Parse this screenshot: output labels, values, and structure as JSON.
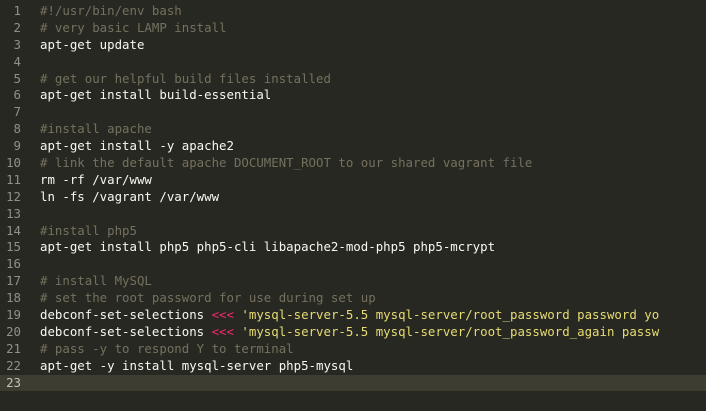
{
  "editor": {
    "language": "bash",
    "active_line": 23,
    "colors": {
      "background": "#272822",
      "gutter_text": "#90908a",
      "comment": "#75715e",
      "plain": "#f8f8f2",
      "keyword": "#f92672",
      "string": "#e6db74"
    },
    "lines": [
      {
        "num": "1",
        "segments": [
          {
            "t": "#!/usr/bin/env bash",
            "c": "comment"
          }
        ]
      },
      {
        "num": "2",
        "segments": [
          {
            "t": "# very basic LAMP install",
            "c": "comment"
          }
        ]
      },
      {
        "num": "3",
        "segments": [
          {
            "t": "apt-get update",
            "c": "plain"
          }
        ]
      },
      {
        "num": "4",
        "segments": []
      },
      {
        "num": "5",
        "segments": [
          {
            "t": "# get our helpful build files installed",
            "c": "comment"
          }
        ]
      },
      {
        "num": "6",
        "segments": [
          {
            "t": "apt-get install build-essential",
            "c": "plain"
          }
        ]
      },
      {
        "num": "7",
        "segments": []
      },
      {
        "num": "8",
        "segments": [
          {
            "t": "#install apache",
            "c": "comment"
          }
        ]
      },
      {
        "num": "9",
        "segments": [
          {
            "t": "apt-get install -y apache2",
            "c": "plain"
          }
        ]
      },
      {
        "num": "10",
        "segments": [
          {
            "t": "# link the default apache DOCUMENT_ROOT to our shared vagrant file",
            "c": "comment"
          }
        ]
      },
      {
        "num": "11",
        "segments": [
          {
            "t": "rm -rf /var/www",
            "c": "plain"
          }
        ]
      },
      {
        "num": "12",
        "segments": [
          {
            "t": "ln -fs /vagrant /var/www",
            "c": "plain"
          }
        ]
      },
      {
        "num": "13",
        "segments": []
      },
      {
        "num": "14",
        "segments": [
          {
            "t": "#install php5",
            "c": "comment"
          }
        ]
      },
      {
        "num": "15",
        "segments": [
          {
            "t": "apt-get install php5 php5-cli libapache2-mod-php5 php5-mcrypt",
            "c": "plain"
          }
        ]
      },
      {
        "num": "16",
        "segments": []
      },
      {
        "num": "17",
        "segments": [
          {
            "t": "# install MySQL",
            "c": "comment"
          }
        ]
      },
      {
        "num": "18",
        "segments": [
          {
            "t": "# set the root password for use during set up",
            "c": "comment"
          }
        ]
      },
      {
        "num": "19",
        "segments": [
          {
            "t": "debconf-set-selections ",
            "c": "plain"
          },
          {
            "t": "<<<",
            "c": "keyword"
          },
          {
            "t": " 'mysql-server-5.5 mysql-server/root_password password yo",
            "c": "string"
          }
        ]
      },
      {
        "num": "20",
        "segments": [
          {
            "t": "debconf-set-selections ",
            "c": "plain"
          },
          {
            "t": "<<<",
            "c": "keyword"
          },
          {
            "t": " 'mysql-server-5.5 mysql-server/root_password_again passw",
            "c": "string"
          }
        ]
      },
      {
        "num": "21",
        "segments": [
          {
            "t": "# pass -y to respond Y to terminal",
            "c": "comment"
          }
        ]
      },
      {
        "num": "22",
        "segments": [
          {
            "t": "apt-get -y install mysql-server php5-mysql",
            "c": "plain"
          }
        ]
      },
      {
        "num": "23",
        "segments": []
      }
    ]
  }
}
